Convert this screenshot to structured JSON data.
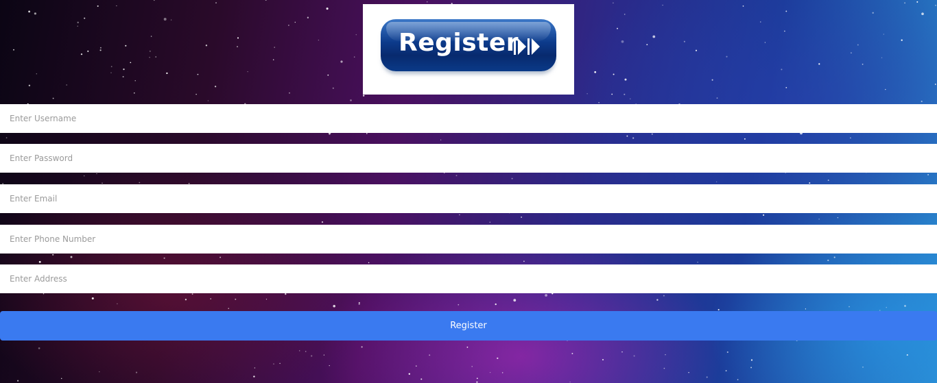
{
  "logo": {
    "text": "Register",
    "icon": "double-chevron-right-icon"
  },
  "form": {
    "username_placeholder": "Enter Username",
    "password_placeholder": "Enter Password",
    "email_placeholder": "Enter Email",
    "phone_placeholder": "Enter Phone Number",
    "address_placeholder": "Enter Address",
    "submit_label": "Register"
  },
  "colors": {
    "button": "#3a7af0",
    "logo_blue": "#0c3a8a",
    "field_background": "#ffffff"
  }
}
